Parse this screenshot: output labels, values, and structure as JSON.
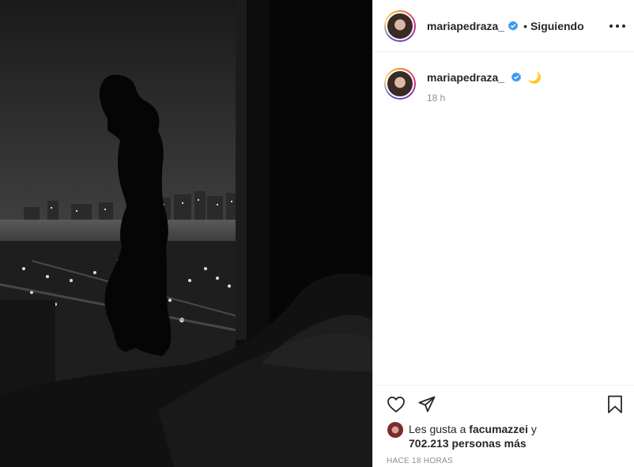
{
  "post": {
    "username": "mariapedraza_",
    "separator": "•",
    "follow_label": "Siguiendo",
    "more_icon": "more-options-icon",
    "verified_color": "#3897f0"
  },
  "caption": {
    "username": "mariapedraza_",
    "text": "🌙",
    "time": "18 h"
  },
  "actions": {
    "like_icon": "heart-icon",
    "share_icon": "paper-plane-icon",
    "save_icon": "bookmark-icon"
  },
  "likes": {
    "prefix": "Les gusta a",
    "user": "facumazzei",
    "conjunction": "y",
    "count": "702.213 personas más"
  },
  "timestamp": "Hace 18 horas"
}
